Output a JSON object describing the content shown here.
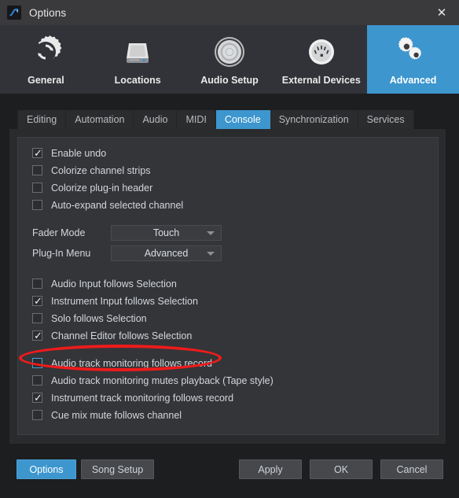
{
  "window": {
    "title": "Options",
    "app_icon": "studio-one-logo-icon",
    "close_label": "✕"
  },
  "topnav": {
    "items": [
      {
        "label": "General",
        "icon": "gear-refresh-icon",
        "active": false
      },
      {
        "label": "Locations",
        "icon": "hard-drive-icon",
        "active": false
      },
      {
        "label": "Audio Setup",
        "icon": "speaker-icon",
        "active": false
      },
      {
        "label": "External Devices",
        "icon": "midi-port-icon",
        "active": false
      },
      {
        "label": "Advanced",
        "icon": "two-gears-icon",
        "active": true
      }
    ]
  },
  "tabs": {
    "items": [
      {
        "label": "Editing",
        "active": false
      },
      {
        "label": "Automation",
        "active": false
      },
      {
        "label": "Audio",
        "active": false
      },
      {
        "label": "MIDI",
        "active": false
      },
      {
        "label": "Console",
        "active": true
      },
      {
        "label": "Synchronization",
        "active": false
      },
      {
        "label": "Services",
        "active": false
      }
    ]
  },
  "console_panel": {
    "group1": [
      {
        "label": "Enable undo",
        "checked": true,
        "focused": false
      },
      {
        "label": "Colorize channel strips",
        "checked": false,
        "focused": false
      },
      {
        "label": "Colorize plug-in header",
        "checked": false,
        "focused": false
      },
      {
        "label": "Auto-expand selected channel",
        "checked": false,
        "focused": false
      }
    ],
    "dropdowns": [
      {
        "label": "Fader Mode",
        "value": "Touch",
        "arrow": "chevron-down-icon"
      },
      {
        "label": "Plug-In Menu",
        "value": "Advanced",
        "arrow": "chevron-down-icon"
      }
    ],
    "group2": [
      {
        "label": "Audio Input follows Selection",
        "checked": false,
        "focused": false
      },
      {
        "label": "Instrument Input follows Selection",
        "checked": true,
        "focused": false
      },
      {
        "label": "Solo follows Selection",
        "checked": false,
        "focused": false
      },
      {
        "label": "Channel Editor follows Selection",
        "checked": true,
        "focused": false
      }
    ],
    "group3": [
      {
        "label": "Audio track monitoring follows record",
        "checked": false,
        "focused": true
      },
      {
        "label": "Audio track monitoring mutes playback (Tape style)",
        "checked": false,
        "focused": false
      },
      {
        "label": "Instrument track monitoring follows record",
        "checked": true,
        "focused": false
      },
      {
        "label": "Cue mix mute follows channel",
        "checked": false,
        "focused": false
      }
    ],
    "check_glyph": "✓"
  },
  "footer": {
    "options": "Options",
    "song_setup": "Song Setup",
    "apply": "Apply",
    "ok": "OK",
    "cancel": "Cancel"
  },
  "annotation": {
    "shape": "red-ellipse-highlight",
    "color": "#ee1b1b",
    "target": "Audio track monitoring follows record"
  },
  "colors": {
    "accent": "#3d96ce",
    "titlebar": "#3a3a3c",
    "topnav_bg": "#313338",
    "panel_outer": "#2a2b2d",
    "panel_inner": "#343539",
    "window_bg": "#1d1e20",
    "focus_border": "#3ea4d8"
  }
}
